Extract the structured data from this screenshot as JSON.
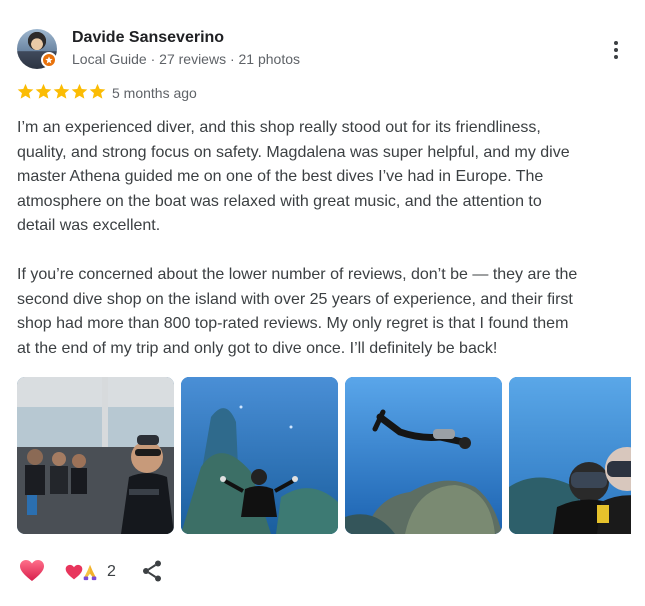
{
  "reviewer": {
    "name": "Davide Sanseverino",
    "meta": "Local Guide · 27 reviews · 21 photos"
  },
  "rating": {
    "stars": 5,
    "max": 5,
    "star_color": "#fbbc04",
    "time": "5 months ago"
  },
  "review": {
    "paragraph1": [
      "I’m an experienced diver, and this shop really stood out for its friendliness,",
      "quality, and strong focus on safety. Magdalena was super helpful, and my dive",
      "master Athena guided me on one of the best dives I’ve had in Europe. The",
      "atmosphere on the boat was relaxed with great music, and the attention to",
      "detail was excellent."
    ],
    "paragraph2": [
      "If you’re concerned about the lower number of reviews, don’t be — they are the",
      "second dive shop on the island with over 25 years of experience, and their first",
      "shop had more than 800 top-rated reviews. My only regret is that I found them",
      "at the end of my trip and only got to dive once. I’ll definitely be back!"
    ]
  },
  "photos": [
    {
      "icon": "boat-selfie-photo"
    },
    {
      "icon": "underwater-diver-photo"
    },
    {
      "icon": "diver-over-rock-photo"
    },
    {
      "icon": "diver-selfie-photo"
    }
  ],
  "actions": {
    "like_icon": "heart-icon",
    "reaction_count": "2",
    "share_icon": "share-icon"
  },
  "colors": {
    "accent_heart": "#e8355c",
    "local_guide_badge": "#e8710a",
    "text_secondary": "#5f6368"
  }
}
